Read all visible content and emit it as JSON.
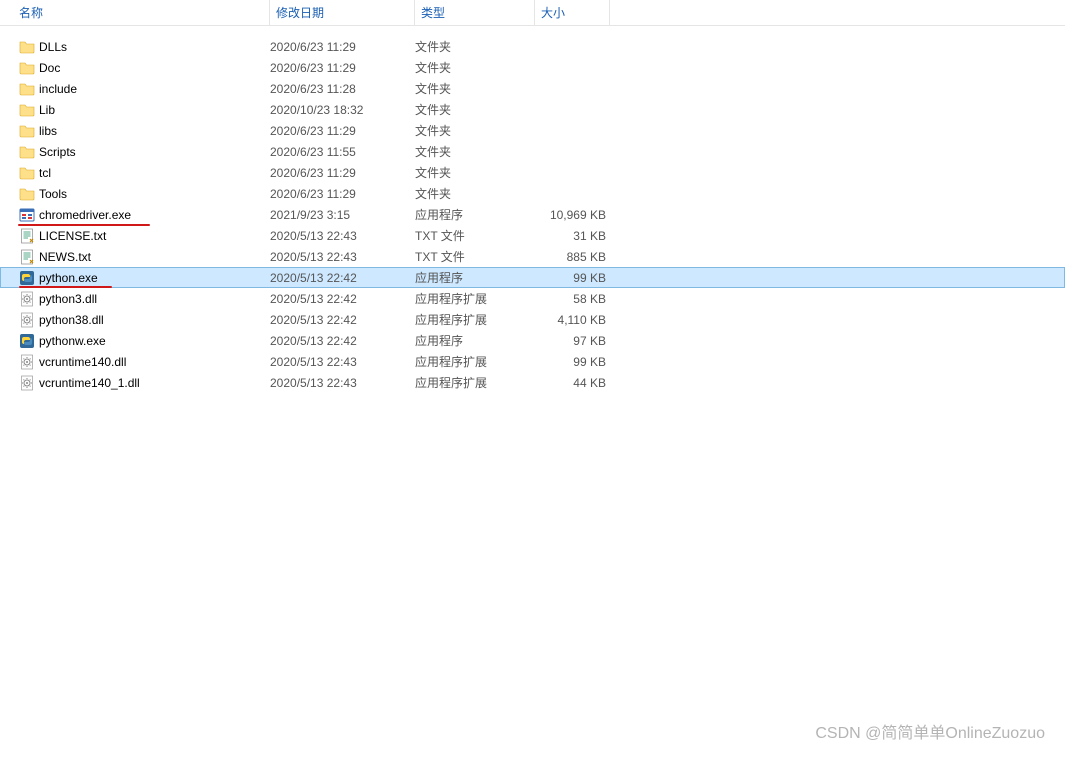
{
  "columns": {
    "name": "名称",
    "date": "修改日期",
    "type": "类型",
    "size": "大小"
  },
  "files": [
    {
      "icon": "folder",
      "name": "DLLs",
      "date": "2020/6/23 11:29",
      "type": "文件夹",
      "size": ""
    },
    {
      "icon": "folder",
      "name": "Doc",
      "date": "2020/6/23 11:29",
      "type": "文件夹",
      "size": ""
    },
    {
      "icon": "folder",
      "name": "include",
      "date": "2020/6/23 11:28",
      "type": "文件夹",
      "size": ""
    },
    {
      "icon": "folder",
      "name": "Lib",
      "date": "2020/10/23 18:32",
      "type": "文件夹",
      "size": ""
    },
    {
      "icon": "folder",
      "name": "libs",
      "date": "2020/6/23 11:29",
      "type": "文件夹",
      "size": ""
    },
    {
      "icon": "folder",
      "name": "Scripts",
      "date": "2020/6/23 11:55",
      "type": "文件夹",
      "size": ""
    },
    {
      "icon": "folder",
      "name": "tcl",
      "date": "2020/6/23 11:29",
      "type": "文件夹",
      "size": ""
    },
    {
      "icon": "folder",
      "name": "Tools",
      "date": "2020/6/23 11:29",
      "type": "文件夹",
      "size": ""
    },
    {
      "icon": "exe",
      "name": "chromedriver.exe",
      "date": "2021/9/23 3:15",
      "type": "应用程序",
      "size": "10,969 KB",
      "underline": true
    },
    {
      "icon": "txt",
      "name": "LICENSE.txt",
      "date": "2020/5/13 22:43",
      "type": "TXT 文件",
      "size": "31 KB"
    },
    {
      "icon": "txt",
      "name": "NEWS.txt",
      "date": "2020/5/13 22:43",
      "type": "TXT 文件",
      "size": "885 KB"
    },
    {
      "icon": "python",
      "name": "python.exe",
      "date": "2020/5/13 22:42",
      "type": "应用程序",
      "size": "99 KB",
      "selected": true,
      "underline": true
    },
    {
      "icon": "dll",
      "name": "python3.dll",
      "date": "2020/5/13 22:42",
      "type": "应用程序扩展",
      "size": "58 KB"
    },
    {
      "icon": "dll",
      "name": "python38.dll",
      "date": "2020/5/13 22:42",
      "type": "应用程序扩展",
      "size": "4,110 KB"
    },
    {
      "icon": "python",
      "name": "pythonw.exe",
      "date": "2020/5/13 22:42",
      "type": "应用程序",
      "size": "97 KB"
    },
    {
      "icon": "dll",
      "name": "vcruntime140.dll",
      "date": "2020/5/13 22:43",
      "type": "应用程序扩展",
      "size": "99 KB"
    },
    {
      "icon": "dll",
      "name": "vcruntime140_1.dll",
      "date": "2020/5/13 22:43",
      "type": "应用程序扩展",
      "size": "44 KB"
    }
  ],
  "watermark": "CSDN @简简单单OnlineZuozuo"
}
